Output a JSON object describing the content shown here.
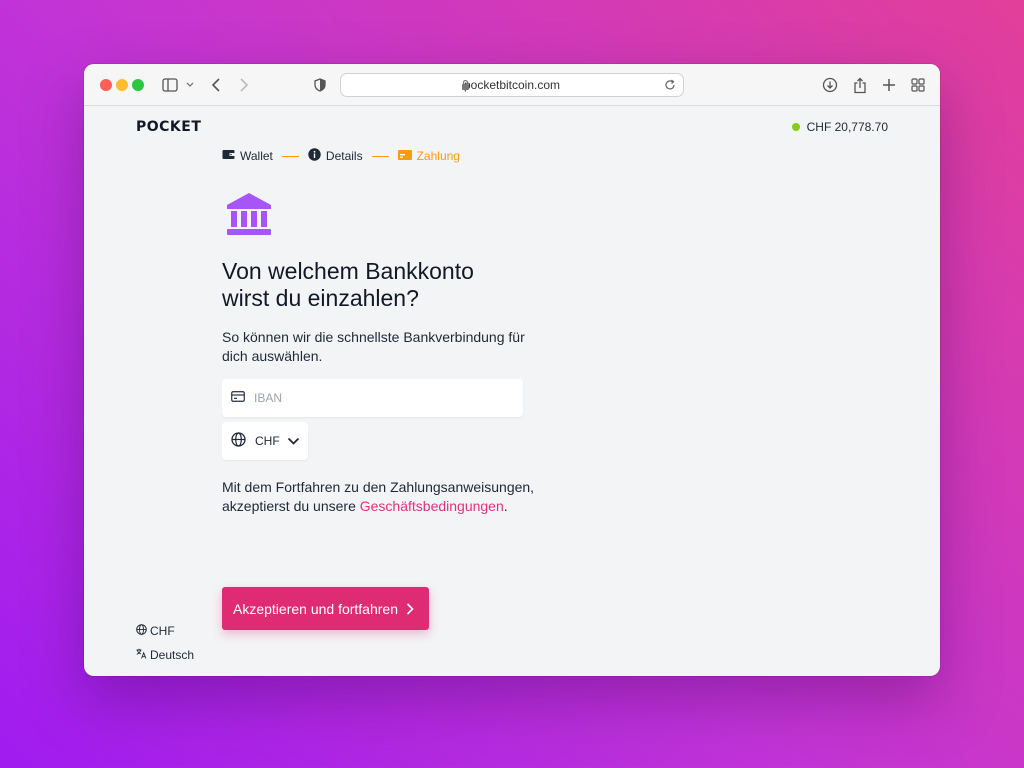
{
  "browser": {
    "url": "pocketbitcoin.com"
  },
  "app": {
    "logo": "POCKET",
    "balance": "CHF 20,778.70"
  },
  "stepper": {
    "steps": [
      {
        "label": "Wallet",
        "icon": "wallet-icon"
      },
      {
        "label": "Details",
        "icon": "info-icon"
      },
      {
        "label": "Zahlung",
        "icon": "payment-card-icon",
        "active": true
      }
    ]
  },
  "main": {
    "icon": "bank-icon",
    "heading_line1": "Von welchem Bankkonto",
    "heading_line2": "wirst du einzahlen?",
    "subtitle": "So können wir die schnellste Bankverbindung für dich auswählen.",
    "iban": {
      "placeholder": "IBAN",
      "value": ""
    },
    "currency": {
      "selected": "CHF"
    },
    "terms_prefix": "Mit dem Fortfahren zu den Zahlungsanweisungen, akzeptierst du unsere ",
    "terms_link": "Geschäftsbedingungen",
    "terms_suffix": ".",
    "cta_label": "Akzeptieren und fortfahren"
  },
  "footer": {
    "currency": "CHF",
    "language": "Deutsch"
  },
  "colors": {
    "accent": "#df2b73",
    "bank_icon": "#a855f7",
    "step_active": "#f59e0b",
    "status_dot": "#84cc16"
  }
}
